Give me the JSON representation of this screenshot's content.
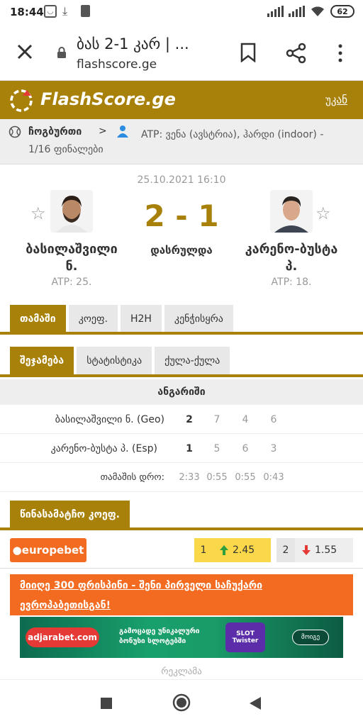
{
  "status_bar": {
    "time": "18:44",
    "battery": "62"
  },
  "browser": {
    "title": "ბას 2-1 კარ | ...",
    "url": "flashscore.ge"
  },
  "header": {
    "brand": "FlashScore.ge",
    "back_label": "უკან"
  },
  "breadcrumb": {
    "sport": "ჩოგბურთი",
    "chevron": ">",
    "league_line1": "ATP: ვენა (ავსტრია), ჰარდი (indoor) -",
    "league_line2": "1/16 ფინალები"
  },
  "match": {
    "datetime": "25.10.2021 16:10",
    "score": "2 - 1",
    "status": "დასრულდა",
    "home": {
      "name_line1": "ბასილაშვილი",
      "name_line2": "ნ.",
      "rank": "ATP: 25."
    },
    "away": {
      "name_line1": "კარენო-ბუსტა",
      "name_line2": "პ.",
      "rank": "ATP: 18."
    }
  },
  "tabs_main": [
    {
      "label": "თამაში",
      "active": true
    },
    {
      "label": "კოეფ.",
      "active": false
    },
    {
      "label": "H2H",
      "active": false
    },
    {
      "label": "კენჭისყრა",
      "active": false
    }
  ],
  "tabs_sub": [
    {
      "label": "შეჯამება",
      "active": true
    },
    {
      "label": "სტატისტიკა",
      "active": false
    },
    {
      "label": "ქულა-ქულა",
      "active": false
    }
  ],
  "scoreboard": {
    "heading": "ანგარიში",
    "rows": [
      {
        "team": "ბასილაშვილი ნ. (Geo)",
        "sets": "2",
        "s1": "7",
        "s2": "4",
        "s3": "6"
      },
      {
        "team": "კარენო-ბუსტა პ. (Esp)",
        "sets": "1",
        "s1": "5",
        "s2": "6",
        "s3": "3"
      }
    ],
    "duration_label": "თამაშის დრო:",
    "durations": [
      "2:33",
      "0:55",
      "0:55",
      "0:43"
    ]
  },
  "odds": {
    "title": "წინასამატჩო კოეფ.",
    "bookmaker": "europebet",
    "o1": {
      "label": "1",
      "value": "2.45",
      "direction": "up"
    },
    "o2": {
      "label": "2",
      "value": "1.55",
      "direction": "down"
    }
  },
  "promo": {
    "line1": "მიიღე 300 ფრისპინი - შენი პირველი საჩუქარი",
    "line2": "ევროპაბეთისგან!"
  },
  "banner": {
    "brand": "adjarabet.com",
    "text_line1": "გამოცადე უნიკალური",
    "text_line2": "ბონუსი სლოტებში",
    "slot_line1": "SLOT",
    "slot_line2": "Twister",
    "cta": "მოიგე"
  },
  "ad_label": "რეკლამა",
  "colors": {
    "accent": "#a8810a",
    "orange": "#f26b21",
    "odd_up_bg": "#fbd84a",
    "up": "#2e9e3f",
    "down": "#e53935"
  }
}
